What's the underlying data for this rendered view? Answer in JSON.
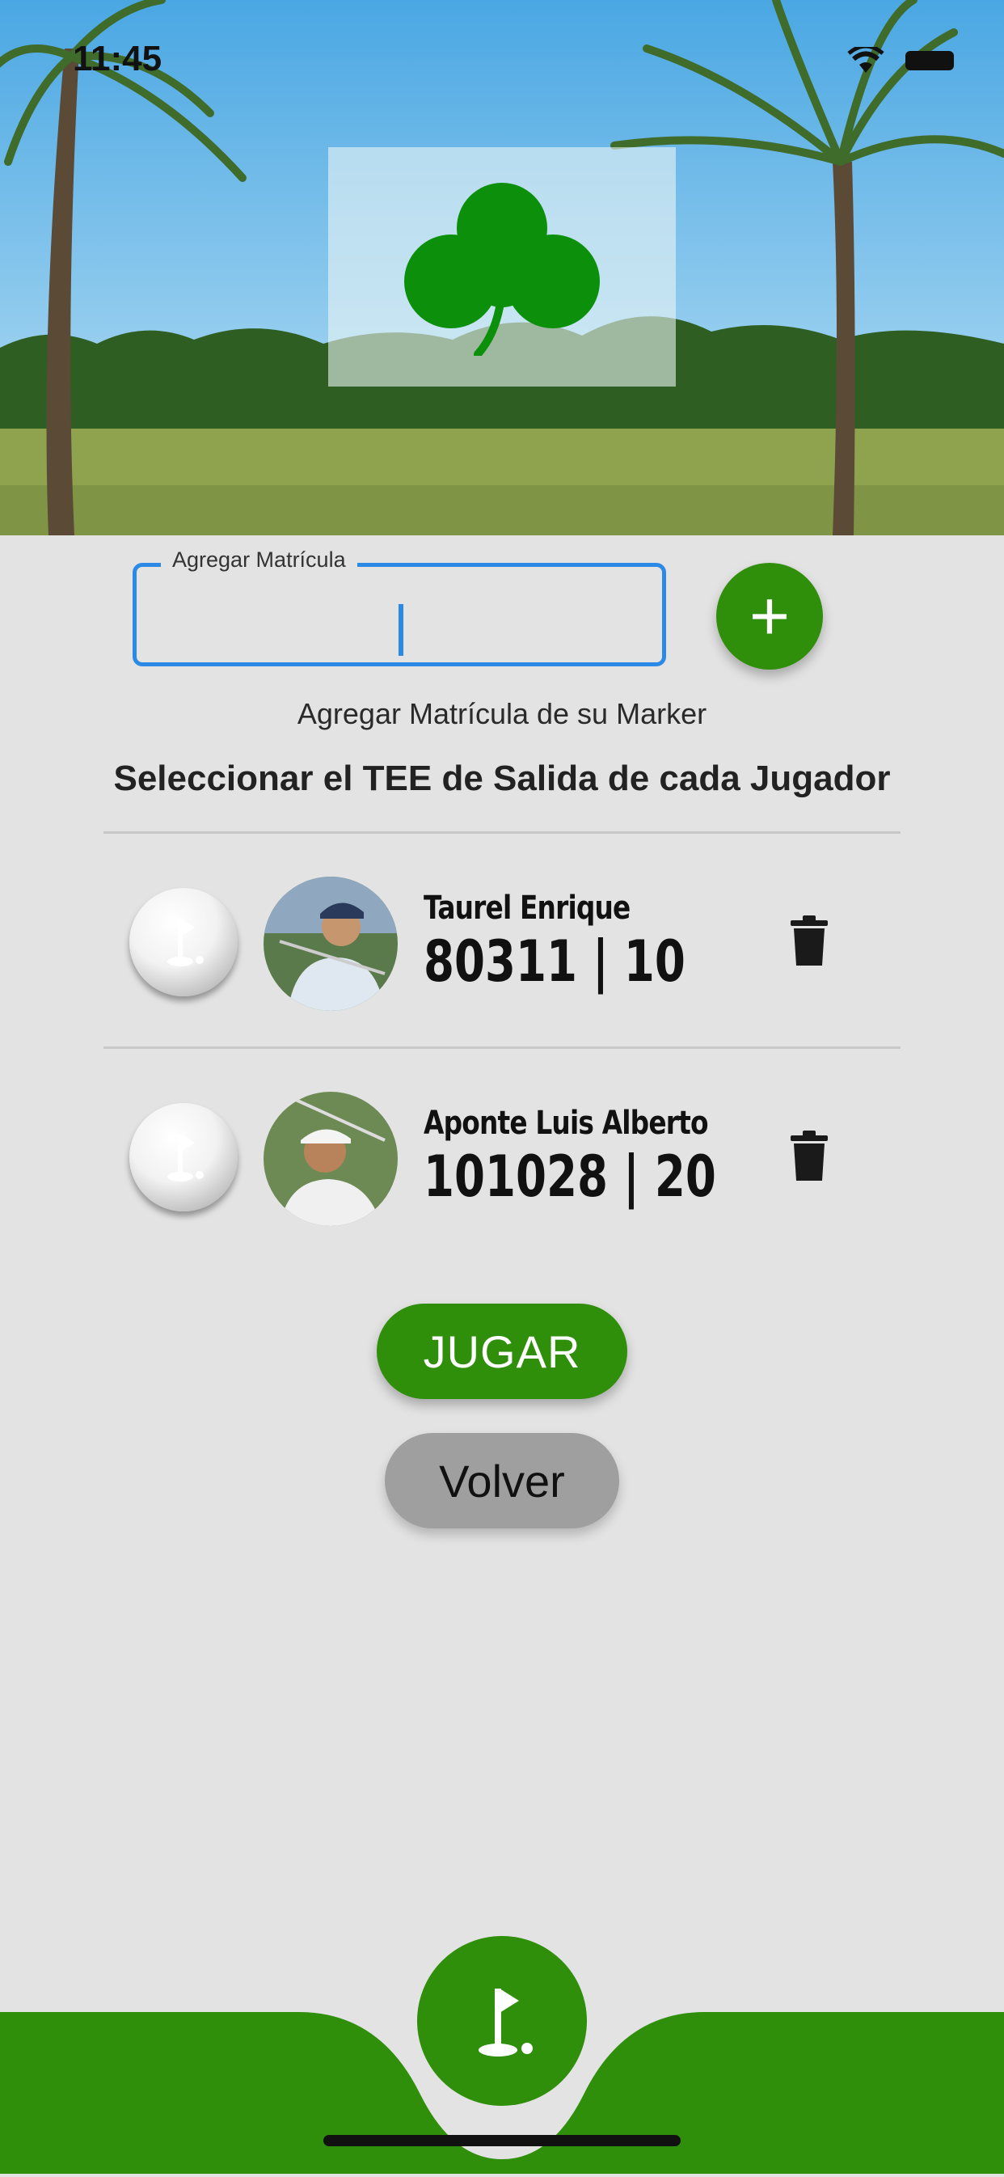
{
  "status": {
    "time": "11:45"
  },
  "colors": {
    "accent_green": "#2f8f0b",
    "field_blue": "#2b8ae6",
    "background": "#e3e3e3",
    "back_gray": "#9f9f9f"
  },
  "header": {
    "logo_icon": "clover-icon",
    "background": "golf-course-photo"
  },
  "form": {
    "field_label": "Agregar Matrícula",
    "field_value": "",
    "add_button_label": "+",
    "helper_text": "Agregar Matrícula de su Marker"
  },
  "section_title": "Seleccionar el TEE de Salida de cada Jugador",
  "players": [
    {
      "name": "Taurel Enrique",
      "stats": "80311 | 10"
    },
    {
      "name": "Aponte Luis Alberto",
      "stats": "101028 | 20"
    }
  ],
  "buttons": {
    "play": "JUGAR",
    "back": "Volver"
  },
  "nav": {
    "center_icon": "golf-flag-icon"
  }
}
